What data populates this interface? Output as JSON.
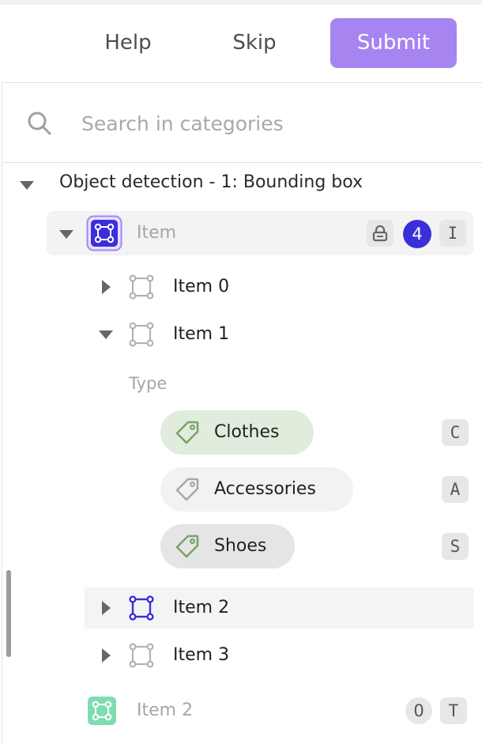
{
  "header": {
    "help_label": "Help",
    "skip_label": "Skip",
    "submit_label": "Submit"
  },
  "search": {
    "placeholder": "Search in categories",
    "icon": "search-icon"
  },
  "tree": {
    "category_title": "Object detection - 1: Bounding box",
    "group_item": {
      "label": "Item",
      "count": "4",
      "shortcut": "I",
      "lock_icon": "lock-icon"
    },
    "items": [
      {
        "label": "Item 0"
      },
      {
        "label": "Item 1",
        "expanded": true
      },
      {
        "label": "Item 2",
        "highlighted": true
      },
      {
        "label": "Item 3"
      }
    ],
    "attribute": {
      "label": "Type",
      "options": [
        {
          "label": "Clothes",
          "shortcut": "C",
          "state": "selected"
        },
        {
          "label": "Accessories",
          "shortcut": "A",
          "state": "default"
        },
        {
          "label": "Shoes",
          "shortcut": "S",
          "state": "hovered"
        }
      ]
    },
    "second_group": {
      "label": "Item 2",
      "count": "0",
      "shortcut": "T"
    }
  },
  "colors": {
    "accent": "#a685f1",
    "bbox_blue": "#3a2fd8",
    "bbox_green": "#7fdcb2",
    "chip_selected": "#e2ecdc",
    "tag_green": "#7aa36a"
  }
}
